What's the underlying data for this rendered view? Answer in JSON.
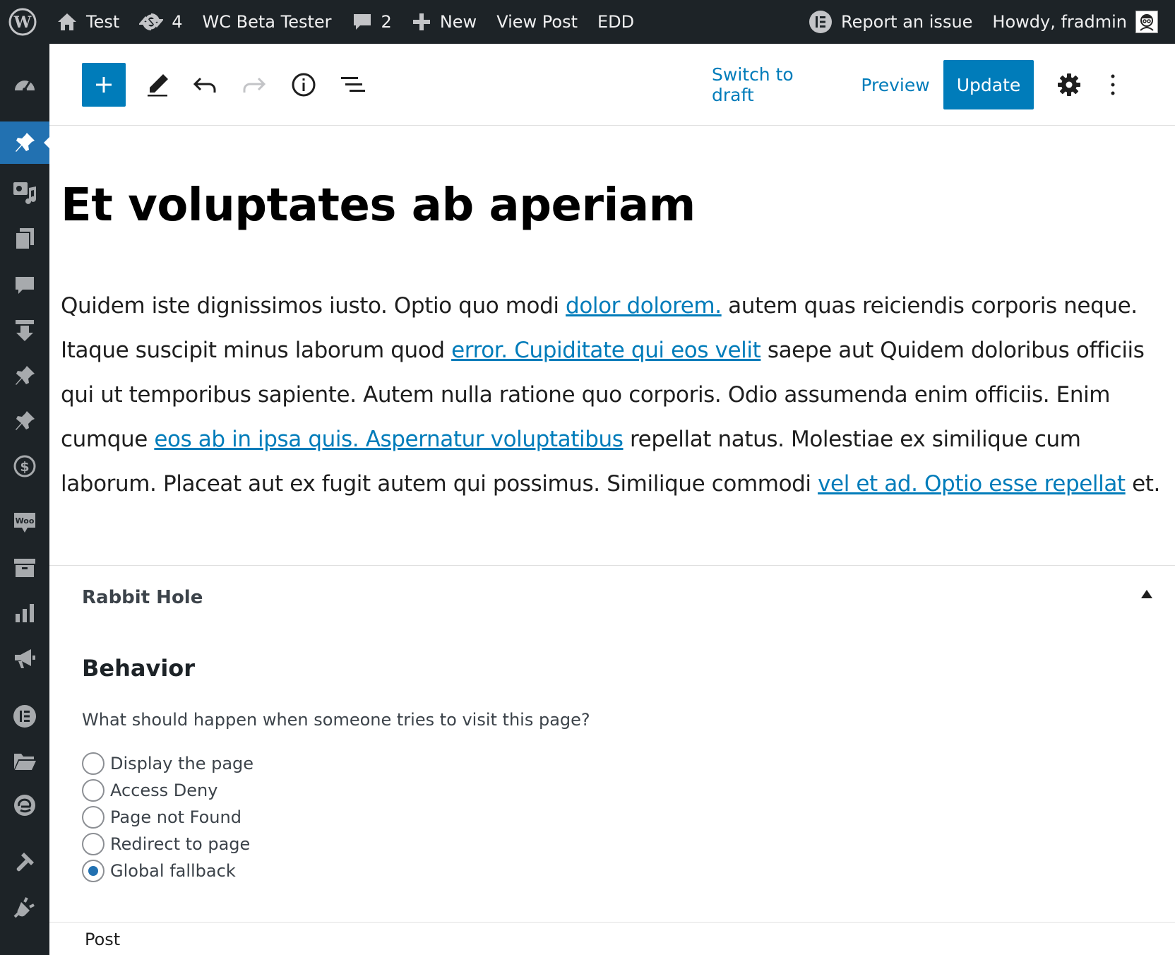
{
  "admin_bar": {
    "site_name": "Test",
    "updates_count": "4",
    "wc_beta": "WC Beta Tester",
    "comments_count": "2",
    "new_label": "New",
    "view_post": "View Post",
    "edd": "EDD",
    "report_issue": "Report an issue",
    "howdy": "Howdy, fradmin"
  },
  "toolbar": {
    "switch_to_draft": "Switch to draft",
    "preview": "Preview",
    "update": "Update"
  },
  "post": {
    "title": "Et voluptates ab aperiam",
    "p1": "Quidem iste dignissimos iusto. Optio quo modi ",
    "link1": "dolor dolorem.",
    "p2": " autem quas reiciendis corporis neque. Itaque suscipit minus laborum quod ",
    "link2": "error. Cupiditate qui eos velit",
    "p3": " saepe aut Quidem doloribus officiis qui ut temporibus sapiente. Autem nulla ratione quo corporis. Odio assumenda enim officiis. Enim cumque ",
    "link3": "eos ab in ipsa quis. Aspernatur voluptatibus",
    "p4": " repellat natus. Molestiae ex similique cum laborum. Placeat aut ex fugit autem qui possimus. Similique commodi ",
    "link4": "vel et ad. Optio esse repellat",
    "p5": " et."
  },
  "metabox": {
    "title": "Rabbit Hole",
    "heading": "Behavior",
    "question": "What should happen when someone tries to visit this page?",
    "options": [
      {
        "label": "Display the page",
        "checked": false
      },
      {
        "label": "Access Deny",
        "checked": false
      },
      {
        "label": "Page not Found",
        "checked": false
      },
      {
        "label": "Redirect to page",
        "checked": false
      },
      {
        "label": "Global fallback",
        "checked": true
      }
    ]
  },
  "footer": {
    "label": "Post"
  },
  "colors": {
    "admin_bg": "#1d2327",
    "accent": "#007cba",
    "active_menu": "#2271b1"
  }
}
